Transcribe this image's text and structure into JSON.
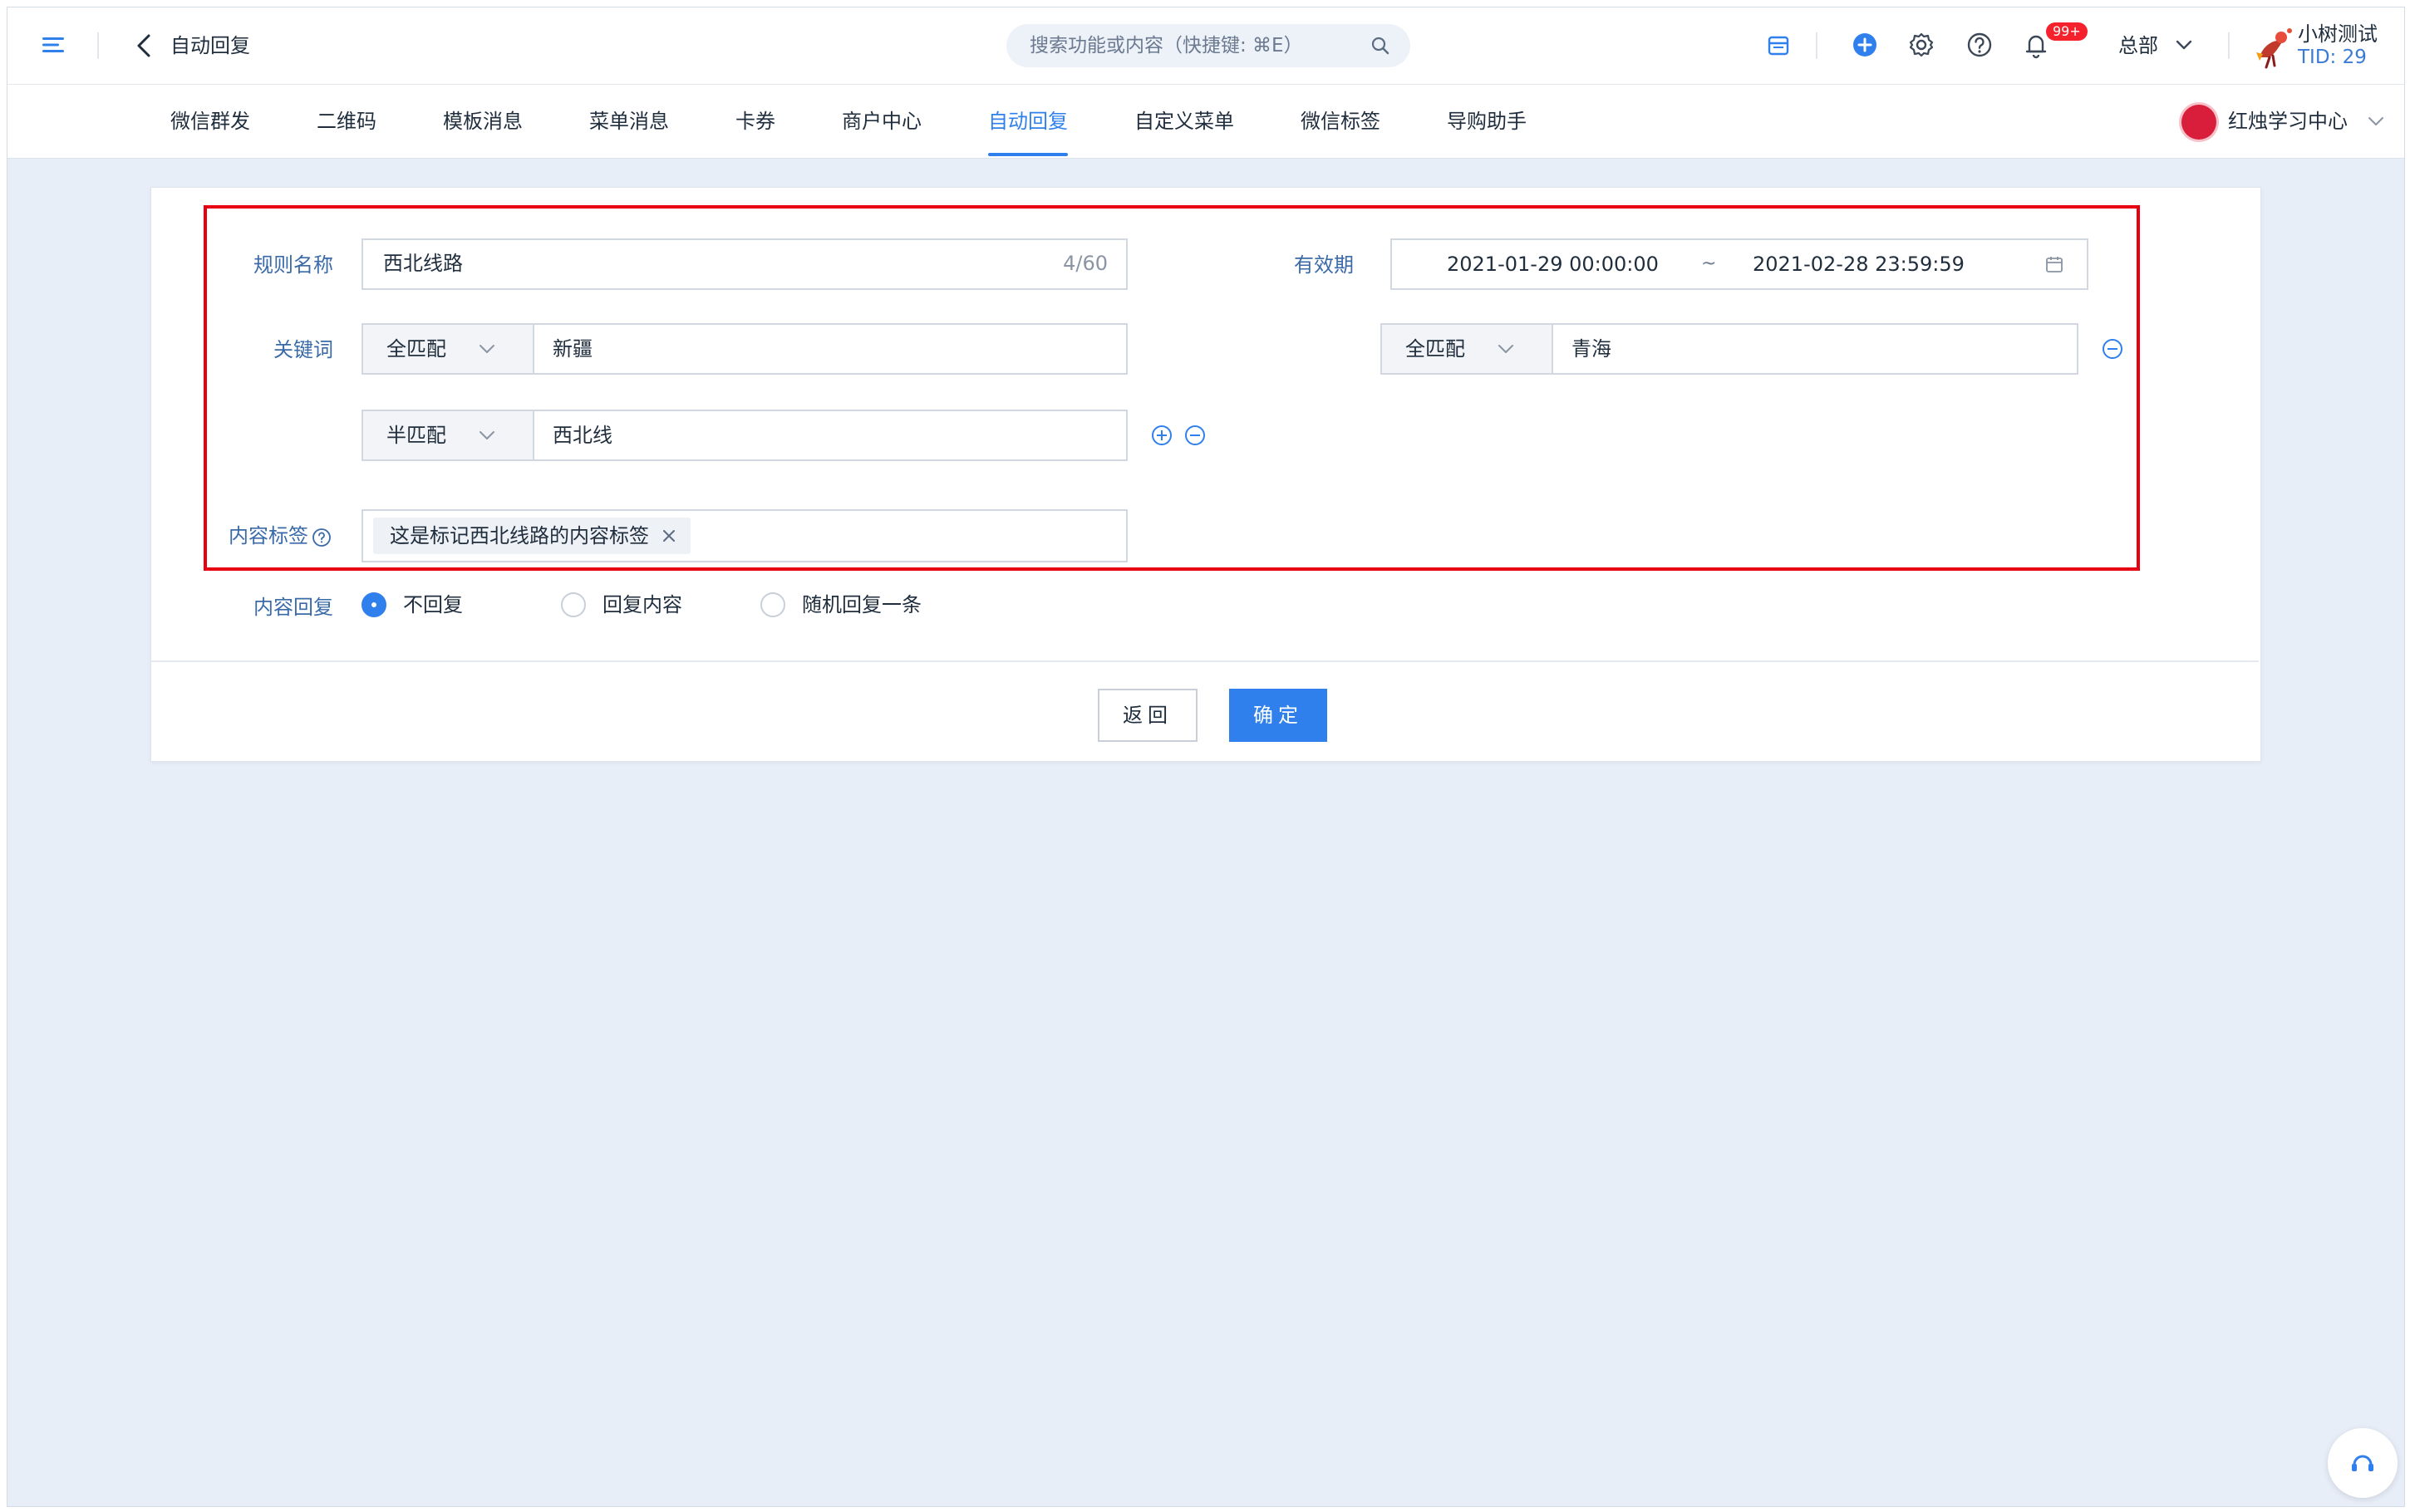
{
  "header": {
    "page_title": "自动回复",
    "search_placeholder": "搜索功能或内容（快捷键: ⌘E）",
    "notification_badge": "99+",
    "department": "总部",
    "user_name": "小树测试",
    "user_tid": "TID: 29",
    "icons": [
      "menu-icon",
      "back-icon",
      "search-icon",
      "store-icon",
      "add-icon",
      "gear-icon",
      "help-icon",
      "bell-icon",
      "chevron-down-icon"
    ]
  },
  "nav": {
    "tabs": [
      {
        "label": "微信群发"
      },
      {
        "label": "二维码"
      },
      {
        "label": "模板消息"
      },
      {
        "label": "菜单消息"
      },
      {
        "label": "卡券"
      },
      {
        "label": "商户中心"
      },
      {
        "label": "自动回复",
        "active": true
      },
      {
        "label": "自定义菜单"
      },
      {
        "label": "微信标签"
      },
      {
        "label": "导购助手"
      }
    ],
    "org_name": "红烛学习中心"
  },
  "form": {
    "rule_name_label": "规则名称",
    "rule_name_value": "西北线路",
    "rule_name_count": "4/60",
    "validity_label": "有效期",
    "validity_start": "2021-01-29 00:00:00",
    "validity_sep": "~",
    "validity_end": "2021-02-28 23:59:59",
    "keyword_label": "关键词",
    "keywords": [
      {
        "match": "全匹配",
        "value": "新疆"
      },
      {
        "match": "全匹配",
        "value": "青海"
      },
      {
        "match": "半匹配",
        "value": "西北线"
      }
    ],
    "content_tag_label": "内容标签",
    "content_tags": [
      "这是标记西北线路的内容标签"
    ],
    "content_reply_label": "内容回复",
    "reply_options": [
      {
        "label": "不回复",
        "selected": true
      },
      {
        "label": "回复内容",
        "selected": false
      },
      {
        "label": "随机回复一条",
        "selected": false
      }
    ]
  },
  "actions": {
    "back_label": "返回",
    "confirm_label": "确定"
  },
  "colors": {
    "accent": "#2f80ed",
    "highlight_border": "#e60012",
    "background": "#e8eef8",
    "badge": "#f5222d"
  }
}
